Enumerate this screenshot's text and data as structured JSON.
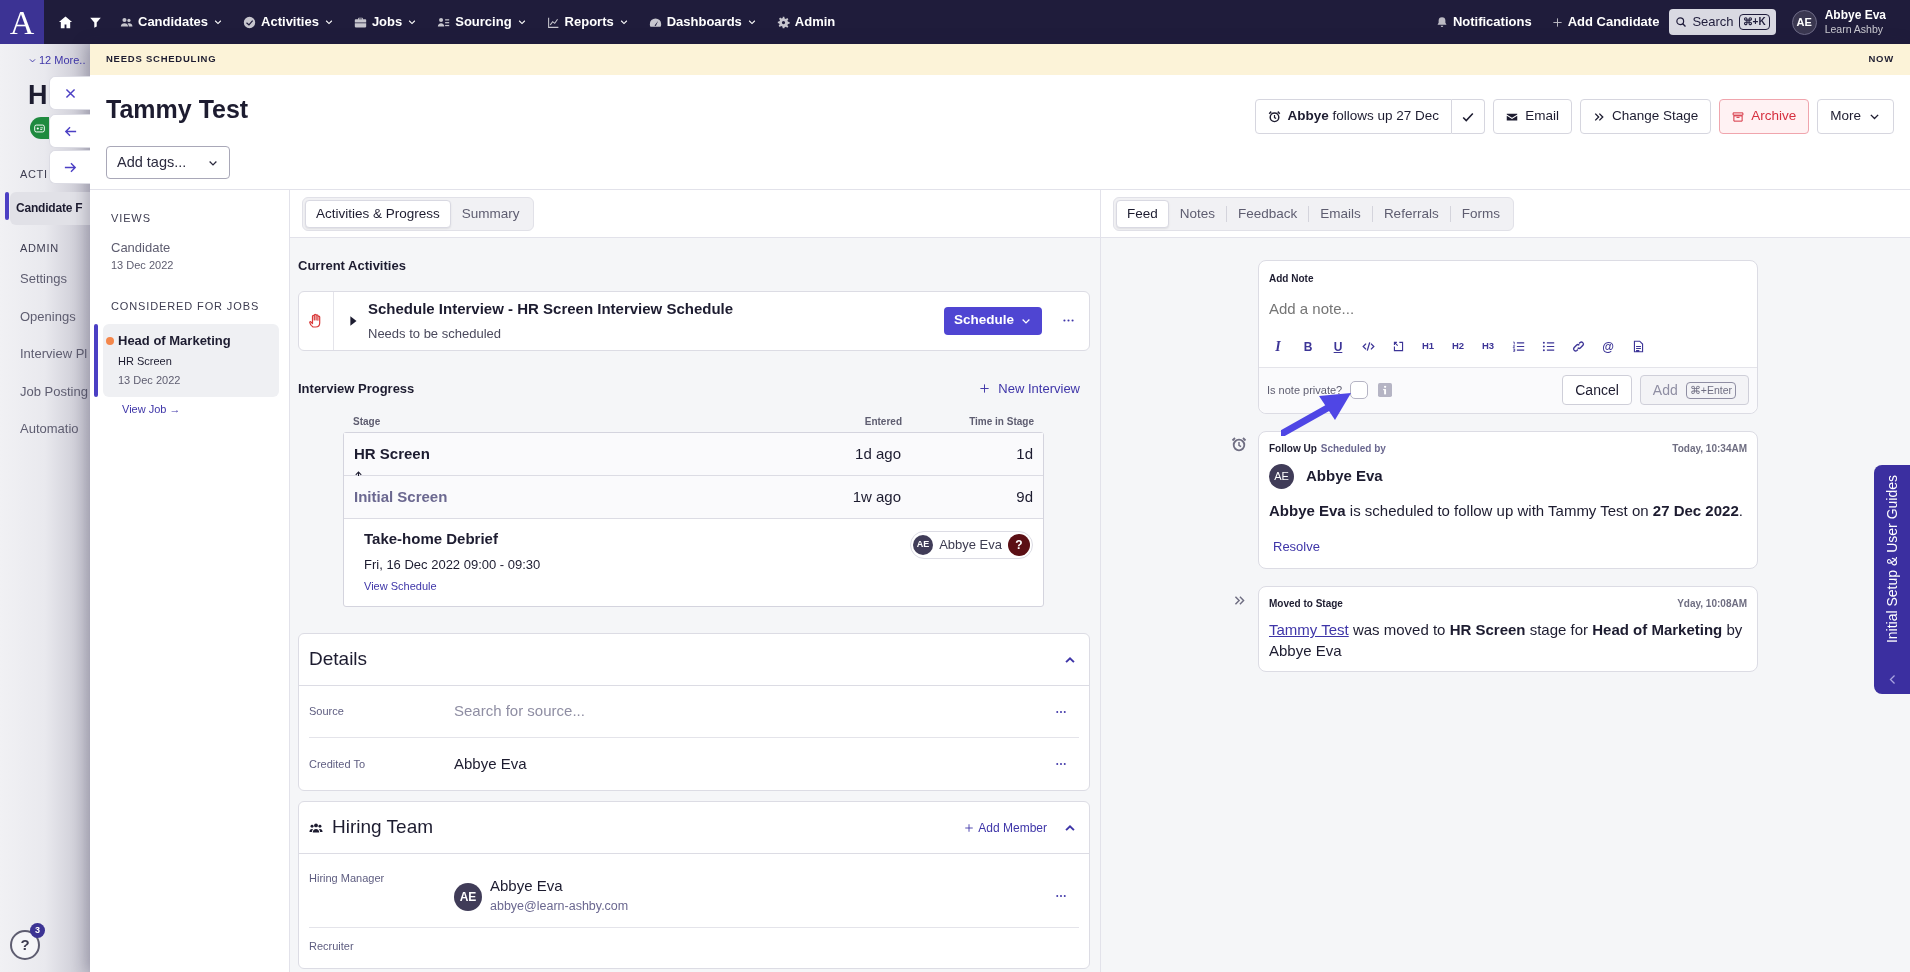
{
  "top_nav": {
    "logo": "A",
    "items": [
      {
        "label": "Candidates",
        "dropdown": true
      },
      {
        "label": "Activities",
        "dropdown": true
      },
      {
        "label": "Jobs",
        "dropdown": true
      },
      {
        "label": "Sourcing",
        "dropdown": true
      },
      {
        "label": "Reports",
        "dropdown": true
      },
      {
        "label": "Dashboards",
        "dropdown": true
      },
      {
        "label": "Admin",
        "dropdown": false
      }
    ],
    "notifications": "Notifications",
    "add_candidate": "Add Candidate",
    "search": {
      "label": "Search",
      "shortcut": "⌘+K"
    },
    "user": {
      "initials": "AE",
      "name": "Abbye Eva",
      "org": "Learn Ashby"
    }
  },
  "background_page": {
    "more_link": "12 More..",
    "heading": "H",
    "nav_heading": "ACTI",
    "nav_items": [
      {
        "label": "Candidate F",
        "selected": true
      }
    ],
    "admin_heading": "ADMIN",
    "admin_items": [
      {
        "label": "Settings",
        "selected": false
      },
      {
        "label": "Openings",
        "selected": false
      },
      {
        "label": "Interview Pl",
        "selected": false
      },
      {
        "label": "Job Posting",
        "selected": false
      },
      {
        "label": "Automatio",
        "selected": false
      }
    ],
    "help": {
      "label": "?",
      "badge": "3"
    }
  },
  "banner": {
    "label": "NEEDS SCHEDULING",
    "time": "NOW"
  },
  "candidate": {
    "name": "Tammy Test",
    "tags_placeholder": "Add tags..."
  },
  "header_actions": {
    "follow_up": "**Abbye** follows up 27 Dec",
    "buttons": [
      {
        "kind": "email",
        "label": "Email"
      },
      {
        "kind": "stage",
        "label": "Change Stage"
      },
      {
        "kind": "archive",
        "label": "Archive"
      },
      {
        "kind": "more",
        "label": "More"
      }
    ]
  },
  "views_sidebar": {
    "views_heading": "VIEWS",
    "views": [
      {
        "title": "Candidate",
        "date": "13 Dec 2022"
      }
    ],
    "jobs_heading": "CONSIDERED FOR JOBS",
    "jobs": [
      {
        "title": "Head of Marketing",
        "stage": "HR Screen",
        "date": "13 Dec 2022",
        "selected": true,
        "color": "#f4874b"
      }
    ],
    "view_job": "View Job →"
  },
  "progress_panel": {
    "tabs": [
      {
        "label": "Activities & Progress",
        "selected": true
      },
      {
        "label": "Summary",
        "selected": false
      }
    ],
    "current_activities": {
      "heading": "Current Activities",
      "items": [
        {
          "title": "Schedule Interview - HR Screen Interview Schedule",
          "subtitle": "Needs to be scheduled",
          "action": "Schedule",
          "expanded": false
        }
      ]
    },
    "interview_progress": {
      "heading": "Interview Progress",
      "new_interview": "New Interview",
      "columns": [
        "Stage",
        "Entered",
        "Time in Stage"
      ],
      "stages": [
        {
          "name": "HR Screen",
          "entered": "1d ago",
          "time": "1d",
          "current": true
        },
        {
          "name": "Initial Screen",
          "entered": "1w ago",
          "time": "9d",
          "current": false
        }
      ],
      "interviews": [
        {
          "title": "Take-home Debrief",
          "when": "Fri, 16 Dec 2022 09:00 - 09:30",
          "link": "View Schedule",
          "interviewer": {
            "initials": "AE",
            "name": "Abbye Eva",
            "status": "?"
          }
        }
      ]
    },
    "details": {
      "title": "Details",
      "expanded": true,
      "fields": [
        {
          "label": "Source",
          "placeholder": "Search for source..."
        },
        {
          "label": "Credited To",
          "value": "Abbye Eva"
        }
      ]
    },
    "hiring_team": {
      "title": "Hiring Team",
      "add": "Add Member",
      "expanded": true,
      "members": [
        {
          "role": "Hiring Manager",
          "initials": "AE",
          "name": "Abbye Eva",
          "email": "abbye@learn-ashby.com"
        },
        {
          "role": "Recruiter"
        }
      ]
    }
  },
  "feed_panel": {
    "tabs": [
      {
        "label": "Feed",
        "selected": true
      },
      {
        "label": "Notes",
        "selected": false
      },
      {
        "label": "Feedback",
        "selected": false
      },
      {
        "label": "Emails",
        "selected": false
      },
      {
        "label": "Referrals",
        "selected": false
      },
      {
        "label": "Forms",
        "selected": false
      }
    ],
    "add_note": {
      "title": "Add Note",
      "placeholder": "Add a note...",
      "toolbar": [
        {
          "kind": "italic",
          "label": "I"
        },
        {
          "kind": "bold",
          "label": "B"
        },
        {
          "kind": "underline",
          "label": "U"
        },
        {
          "kind": "code"
        },
        {
          "kind": "embed"
        },
        {
          "kind": "heading",
          "label": "H1"
        },
        {
          "kind": "heading",
          "label": "H2"
        },
        {
          "kind": "heading",
          "label": "H3"
        },
        {
          "kind": "ordered-list"
        },
        {
          "kind": "bullet-list"
        },
        {
          "kind": "link"
        },
        {
          "kind": "mention",
          "label": "@"
        },
        {
          "kind": "file"
        }
      ],
      "private_label": "Is note private?",
      "private": false,
      "cancel": "Cancel",
      "add": "Add",
      "shortcut": "⌘+Enter"
    },
    "feed": [
      {
        "kind": "follow-up",
        "title": "Follow Up",
        "subtitle": "Scheduled by",
        "time": "Today, 10:34AM",
        "author": {
          "initials": "AE",
          "name": "Abbye Eva"
        },
        "body": "**Abbye Eva** is scheduled to follow up with Tammy Test on **27 Dec 2022**.",
        "action": "Resolve"
      },
      {
        "kind": "stage-move",
        "title": "Moved to Stage",
        "time": "Yday, 10:08AM",
        "link": "Tammy Test",
        "body": " was moved to **HR Screen** stage for **Head of Marketing** by Abbye Eva"
      }
    ]
  },
  "guide_tab": {
    "label": "Initial Setup & User Guides"
  }
}
